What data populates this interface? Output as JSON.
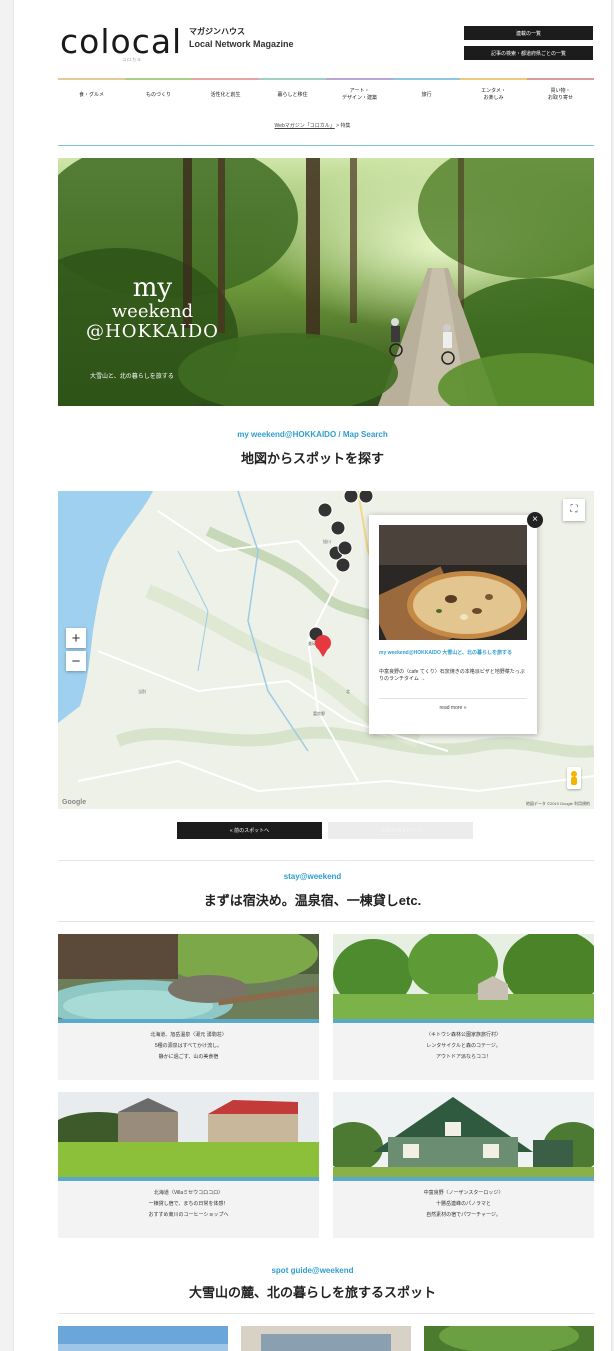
{
  "header": {
    "logo": "colocal",
    "logo_sub": "コロカル",
    "tagline_jp": "マガジンハウス",
    "tagline_en": "Local Network Magazine",
    "btn_serialization": "連載の一覧",
    "btn_articles": "記事の検索・都道府県ごとの一覧"
  },
  "nav": {
    "items": [
      {
        "line1": "食・グルメ",
        "line2": "",
        "color": "#e8c79a"
      },
      {
        "line1": "ものづくり",
        "line2": "",
        "color": "#a9cf8b"
      },
      {
        "line1": "活性化と創生",
        "line2": "",
        "color": "#e7a6a6"
      },
      {
        "line1": "暮らしと移住",
        "line2": "",
        "color": "#9fd1c1"
      },
      {
        "line1": "アート・",
        "line2": "デザイン・建築",
        "color": "#b9a6d6"
      },
      {
        "line1": "旅行",
        "line2": "",
        "color": "#8fc6e3"
      },
      {
        "line1": "エンタメ・",
        "line2": "お楽しみ",
        "color": "#f0c97c"
      },
      {
        "line1": "買い物・",
        "line2": "お取り寄せ",
        "color": "#d79b9b"
      }
    ]
  },
  "breadcrumb": {
    "home": "Webマガジン「コロカル」",
    "sep": ">",
    "current": "特集"
  },
  "hero": {
    "title_l1": "my",
    "title_l2": "weekend",
    "title_l3": "@HOKKAIDO",
    "caption": "大雪山と、北の暮らしを旅する"
  },
  "map_section": {
    "en": "my weekend@HOKKAIDO / Map Search",
    "jp": "地図からスポットを探す"
  },
  "map": {
    "zoom_in": "+",
    "zoom_out": "−",
    "credit": "地図データ ©2019 Google 利用規約",
    "google": "Google",
    "towns": [
      "当別",
      "旭川",
      "美瑛",
      "富良野",
      "北"
    ],
    "popup": {
      "close": "×",
      "title": "my weekend@HOKKAIDO 大雪山と、北の暮らしを旅する",
      "desc": "中富良野の〈cafe てくり〉石窯焼きの本格派ピザと地野菜たっぷりのランチタイム →",
      "more": "read more »"
    },
    "fullscreen": "⛶"
  },
  "map_nav": {
    "prev": "« 前のスポットへ",
    "next": "次のスポットへ »"
  },
  "stay_section": {
    "en": "stay@weekend",
    "jp": "まずは宿決め。温泉宿、一棟貸しetc."
  },
  "cards": [
    {
      "line1": "北海道、旭岳温泉〈湯元 湧駒荘〉",
      "line2": "5種の源泉はすべてかけ流し。",
      "line3": "静かに過ごす、山の美食宿"
    },
    {
      "line1": "〈キトウシ森林公園家族旅行村〉",
      "line2": "レンタサイクルと森のコテージ。",
      "line3": "アウトドア派ならココ！"
    },
    {
      "line1": "北海道〈Villaミセウコロコロ〉",
      "line2": "一棟貸し宿で、まちの日常を体感！",
      "line3": "おすすめ東川のコーヒーショップへ"
    },
    {
      "line1": "中富良野〈ノーザンスターロッジ〉",
      "line2": "十勝岳連峰のパノラマと",
      "line3": "自然素材の宿でパワーチャージ。"
    }
  ],
  "spot_section": {
    "en": "spot guide@weekend",
    "jp": "大雪山の麓、北の暮らしを旅するスポット"
  }
}
